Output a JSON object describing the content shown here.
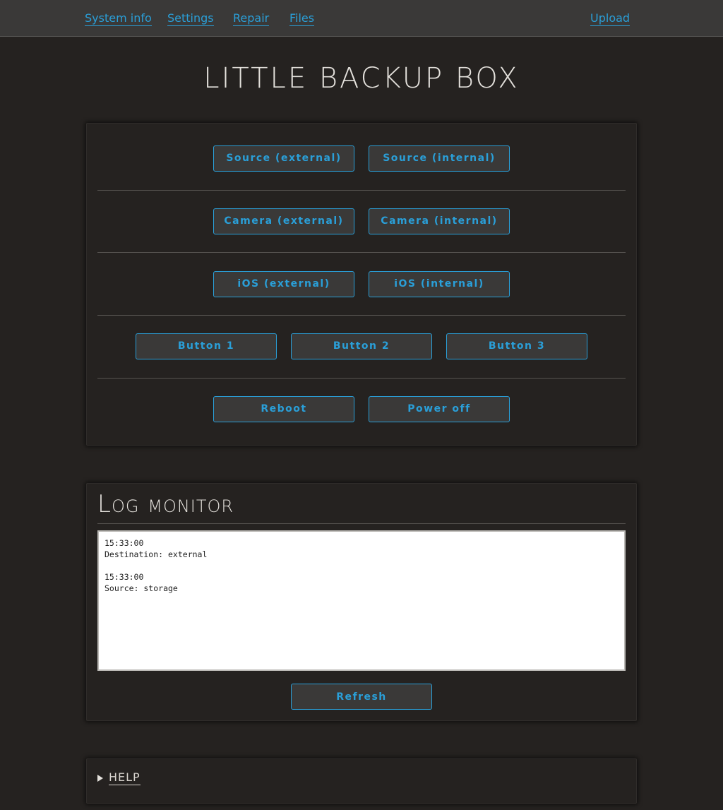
{
  "nav": {
    "items": [
      {
        "label": "System info"
      },
      {
        "label": "Settings"
      },
      {
        "label": "Repair"
      },
      {
        "label": "Files"
      }
    ],
    "upload": "Upload"
  },
  "header": {
    "title": "LITTLE BACKUP BOX"
  },
  "controls": {
    "source_external": "Source (external)",
    "source_internal": "Source (internal)",
    "camera_external": "Camera (external)",
    "camera_internal": "Camera (internal)",
    "ios_external": "iOS (external)",
    "ios_internal": "iOS (internal)",
    "button1": "Button 1",
    "button2": "Button 2",
    "button3": "Button 3",
    "reboot": "Reboot",
    "power_off": "Power off"
  },
  "log": {
    "title": "Log monitor",
    "content": "15:33:00\nDestination: external\n\n15:33:00\nSource: storage",
    "refresh": "Refresh"
  },
  "help": {
    "label": "HELP"
  },
  "colors": {
    "accent": "#2a9fd8",
    "background": "#252220",
    "nav_background": "#3a3938"
  }
}
